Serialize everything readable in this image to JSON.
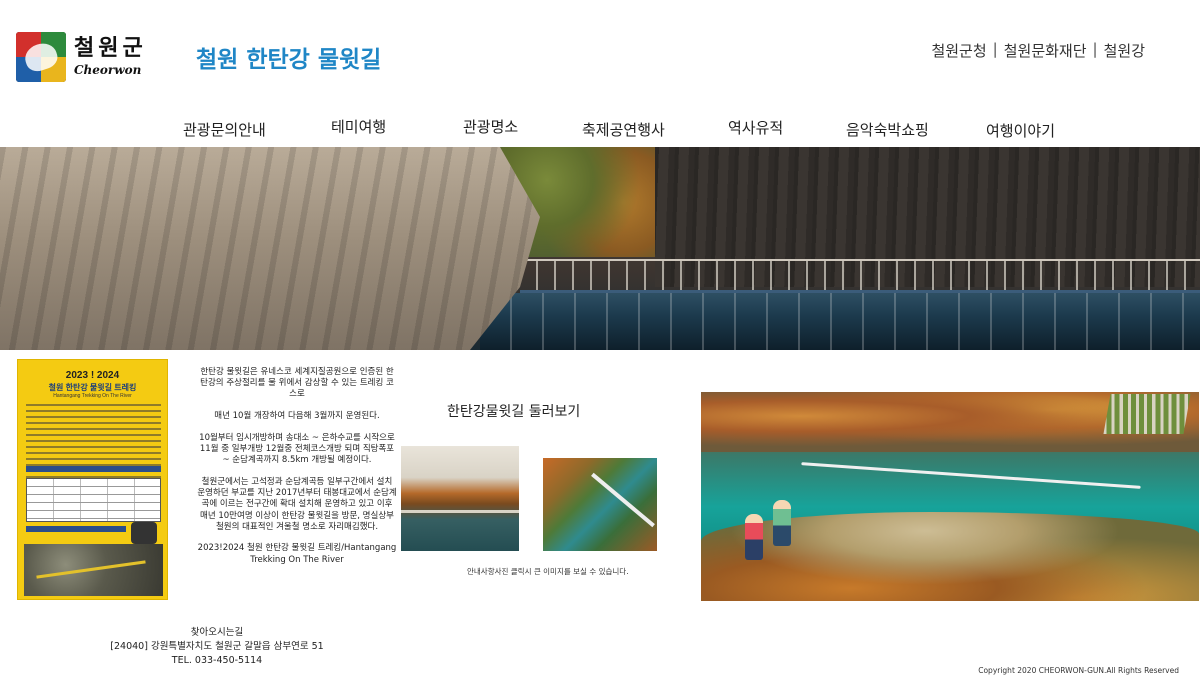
{
  "header": {
    "logo": {
      "ko": "철원군",
      "en": "Cheorwon"
    },
    "site_title": "철원 한탄강 물윗길",
    "util_links": [
      "철원군청",
      "철원문화재단",
      "철원강"
    ],
    "separator": "|"
  },
  "nav": {
    "items": [
      "관광문의안내",
      "테미여행",
      "관광명소",
      "축제공연행사",
      "역사유적",
      "음악숙박쇼핑",
      "여행이야기"
    ]
  },
  "poster": {
    "year": "2023 ! 2024",
    "title": "철원 한탄강 물윗길 트레킹",
    "subtitle": "Hantangang Trekking On The River"
  },
  "description": {
    "paragraphs": [
      "한탄강 물윗길은 유네스코 세계지질공원으로 인증된 한탄강의 주상절리를 물 위에서 감상할 수 있는 트레킹 코스로",
      "매년 10월 개장하여 다음해 3월까지 운영된다.",
      "10월부터 임시개방하며 송대소 ~ 은하수교를 시작으로 11월 중 일부개방 12월중 전체코스개방 되며 직탕폭포 ~ 순담계곡까지 8.5km 개방될 예정이다.",
      "철원군에서는 고석정과 순담계곡등 일부구간에서 설치 운영하던 부교를 지난 2017년부터 태봉대교에서 순담계곡에 이르는 전구간에 확대 설치해 운영하고 있고 이후 매년 10만여명 이상이 한탄강 물윗길을 방문, 명실상부 철원의 대표적인 겨울철 명소로 자리매김했다.",
      "2023!2024 철원 한탄강 물윗길 트레킹/Hantangang Trekking On The River"
    ]
  },
  "tour": {
    "title": "한탄강물윗길 둘러보기",
    "caption": "안내사항사진 클릭시 큰 이미지를 보실 수 있습니다."
  },
  "footer": {
    "heading": "찾아오시는길",
    "address": "[24040] 강원특별자치도 철원군 갈말읍 삼부연로 51",
    "tel": "TEL. 033-450-5114",
    "copyright": "Copyright  2020 CHEORWON-GUN.All Rights Reserved"
  }
}
